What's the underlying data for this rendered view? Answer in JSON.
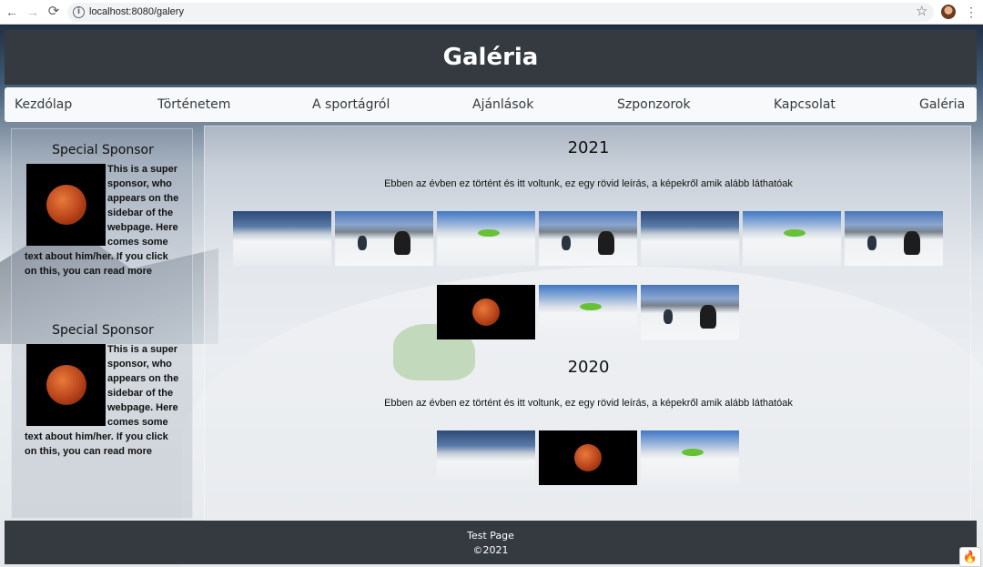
{
  "browser": {
    "back_icon": "←",
    "forward_icon": "→",
    "reload_icon": "⟳",
    "info_icon": "i",
    "url": "localhost:8080/galery",
    "star_icon": "☆",
    "menu_icon": "⋮"
  },
  "header": {
    "title": "Galéria"
  },
  "nav": {
    "items": [
      {
        "label": "Kezdólap"
      },
      {
        "label": "Történetem"
      },
      {
        "label": "A sportágról"
      },
      {
        "label": "Ajánlások"
      },
      {
        "label": "Szponzorok"
      },
      {
        "label": "Kapcsolat"
      },
      {
        "label": "Galéria"
      }
    ]
  },
  "sidebar": {
    "sponsors": [
      {
        "title": "Special Sponsor",
        "image": "red-moon",
        "text": "This is a super sponsor, who appears on the sidebar of the webpage. Here comes some text about him/her. If you click on this, you can read more"
      },
      {
        "title": "Special Sponsor",
        "image": "red-moon",
        "text": "This is a super sponsor, who appears on the sidebar of the webpage. Here comes some text about him/her. If you click on this, you can read more"
      }
    ]
  },
  "gallery": {
    "sections": [
      {
        "year": "2021",
        "description": "Ebben az évben ez történt és itt voltunk, ez egy rövid leírás, a képekről amik alább láthatóak",
        "images": [
          "landscape",
          "ski",
          "green",
          "ski",
          "landscape",
          "green",
          "ski",
          "red-moon",
          "green",
          "ski"
        ]
      },
      {
        "year": "2020",
        "description": "Ebben az évben ez történt és itt voltunk, ez egy rövid leírás, a képekről amik alább láthatóak",
        "images": [
          "landscape",
          "red-moon",
          "green"
        ]
      }
    ]
  },
  "footer": {
    "line1": "Test Page",
    "line2": "©2021"
  },
  "widget": {
    "icon": "🔥"
  },
  "colors": {
    "header_bg": "#343a40",
    "nav_bg": "#f8f9fa",
    "footer_bg": "#343a40"
  }
}
